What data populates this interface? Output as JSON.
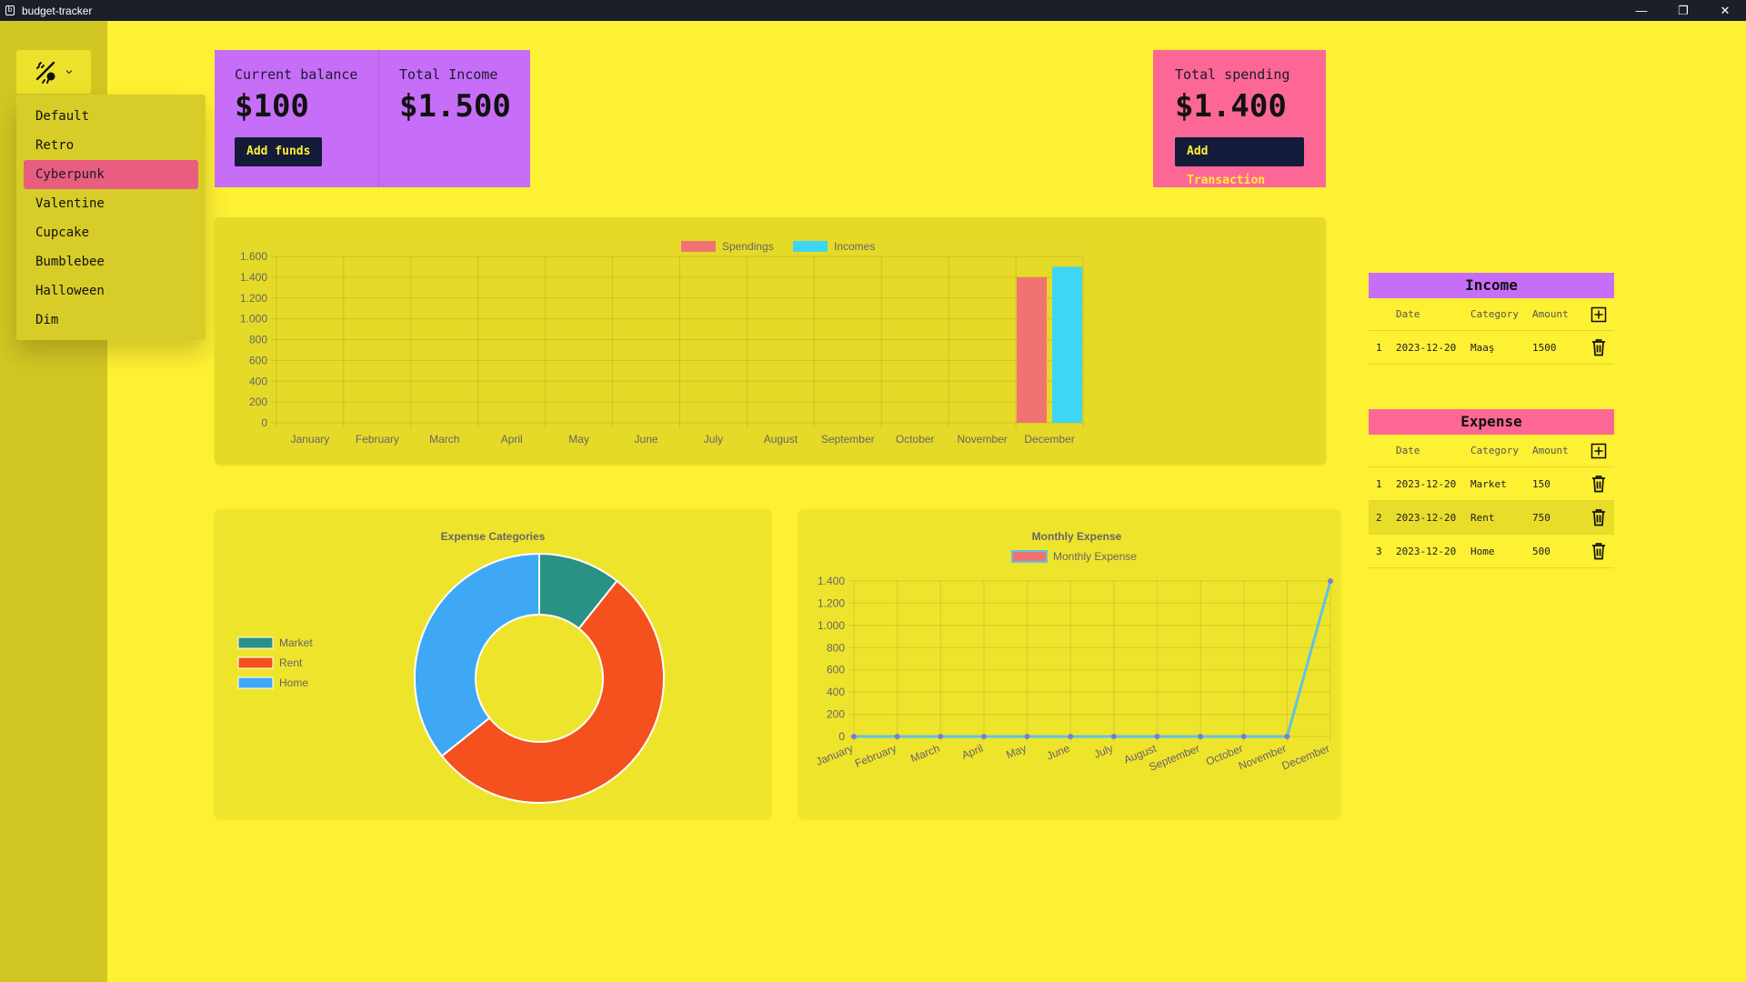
{
  "window": {
    "title": "budget-tracker",
    "controls": [
      "—",
      "❐",
      "✕"
    ]
  },
  "theme": {
    "icon": "palette-icon",
    "items": [
      "Default",
      "Retro",
      "Cyberpunk",
      "Valentine",
      "Cupcake",
      "Bumblebee",
      "Halloween",
      "Dim"
    ],
    "active": "Cyberpunk"
  },
  "stats": {
    "balance_title": "Current balance",
    "balance_value": "$100",
    "add_funds": "Add funds",
    "income_title": "Total Income",
    "income_value": "$1.500",
    "spending_title": "Total spending",
    "spending_value": "$1.400",
    "add_transaction": "Add Transaction"
  },
  "colors": {
    "spendings": "#f07371",
    "incomes": "#3dd6f5",
    "market": "#2a9186",
    "rent": "#f4511e",
    "home": "#3fa8f4",
    "line": "#5ec3e6"
  },
  "chart_data": [
    {
      "type": "bar",
      "title": "",
      "categories": [
        "January",
        "February",
        "March",
        "April",
        "May",
        "June",
        "July",
        "August",
        "September",
        "October",
        "November",
        "December"
      ],
      "series": [
        {
          "name": "Spendings",
          "values": [
            0,
            0,
            0,
            0,
            0,
            0,
            0,
            0,
            0,
            0,
            0,
            1400
          ]
        },
        {
          "name": "Incomes",
          "values": [
            0,
            0,
            0,
            0,
            0,
            0,
            0,
            0,
            0,
            0,
            0,
            1500
          ]
        }
      ],
      "ylim": [
        0,
        1600
      ],
      "yticks": [
        "0",
        "200",
        "400",
        "600",
        "800",
        "1.000",
        "1.200",
        "1.400",
        "1.600"
      ],
      "legend": "top",
      "grid": true
    },
    {
      "type": "pie",
      "title": "Expense Categories",
      "labels": [
        "Market",
        "Rent",
        "Home"
      ],
      "values": [
        150,
        750,
        500
      ],
      "legend": "left"
    },
    {
      "type": "line",
      "title": "Monthly Expense",
      "categories": [
        "January",
        "February",
        "March",
        "April",
        "May",
        "June",
        "July",
        "August",
        "September",
        "October",
        "November",
        "December"
      ],
      "series": [
        {
          "name": "Monthly Expense",
          "values": [
            0,
            0,
            0,
            0,
            0,
            0,
            0,
            0,
            0,
            0,
            0,
            1400
          ]
        }
      ],
      "ylim": [
        0,
        1400
      ],
      "yticks": [
        "0",
        "200",
        "400",
        "600",
        "800",
        "1.000",
        "1.200",
        "1.400"
      ],
      "legend": "top",
      "grid": true
    }
  ],
  "income_table": {
    "title": "Income",
    "headers": [
      "Date",
      "Category",
      "Amount"
    ],
    "rows": [
      {
        "n": "1",
        "date": "2023-12-20",
        "category": "Maaş",
        "amount": "1500"
      }
    ]
  },
  "expense_table": {
    "title": "Expense",
    "headers": [
      "Date",
      "Category",
      "Amount"
    ],
    "rows": [
      {
        "n": "1",
        "date": "2023-12-20",
        "category": "Market",
        "amount": "150"
      },
      {
        "n": "2",
        "date": "2023-12-20",
        "category": "Rent",
        "amount": "750"
      },
      {
        "n": "3",
        "date": "2023-12-20",
        "category": "Home",
        "amount": "500"
      }
    ]
  }
}
